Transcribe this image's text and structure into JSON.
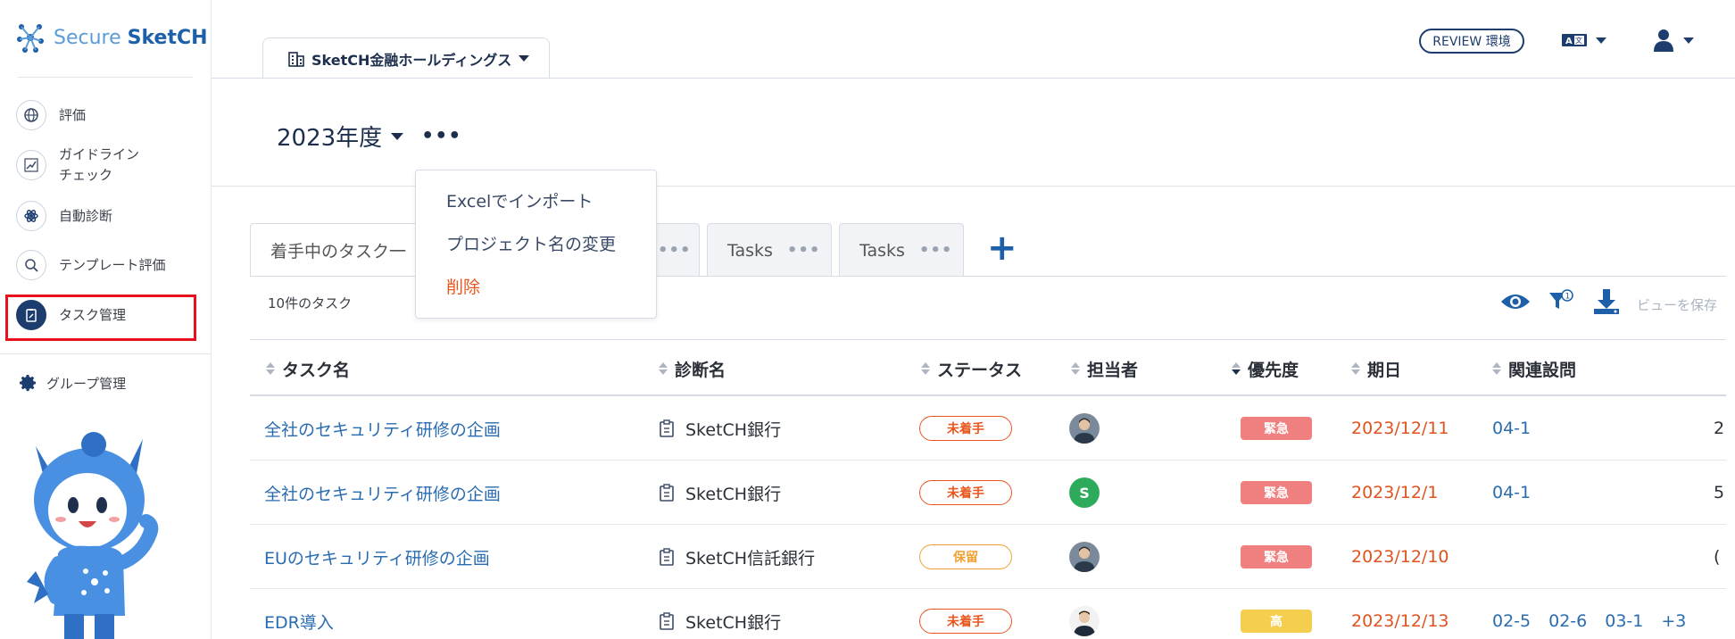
{
  "brand": {
    "name_light": "Secure ",
    "name_bold": "SketCH"
  },
  "sidebar": {
    "items": [
      {
        "label": "評価",
        "icon": "globe-icon"
      },
      {
        "label": "ガイドライン\nチェック",
        "icon": "chart-icon"
      },
      {
        "label": "自動診断",
        "icon": "atom-icon"
      },
      {
        "label": "テンプレート評価",
        "icon": "search-icon"
      },
      {
        "label": "タスク管理",
        "icon": "clipboard-icon",
        "active": true
      }
    ],
    "group_label": "グループ管理"
  },
  "header": {
    "company": "SketCH金融ホールディングス",
    "review_badge": "REVIEW 環境",
    "year": "2023年度",
    "more": "•••"
  },
  "menu": {
    "items": [
      "Excelでインポート",
      "プロジェクト名の変更",
      "削除"
    ]
  },
  "view_tabs": [
    {
      "label": "着手中のタスク一",
      "dots": "•••",
      "active": true
    },
    {
      "label": "Tasks",
      "dots": "•••"
    },
    {
      "label": "Tasks",
      "dots": "•••"
    }
  ],
  "add_tab": "+",
  "toolbar": {
    "count": "10件のタスク",
    "save_view": "ビューを保存",
    "filter_count": "1"
  },
  "table": {
    "columns": [
      "タスク名",
      "診断名",
      "ステータス",
      "担当者",
      "優先度",
      "期日",
      "関連設問"
    ],
    "rows": [
      {
        "task": "全社のセキュリティ研修の企画",
        "diagnosis": "SketCH銀行",
        "status": "未着手",
        "status_color": "#e8561e",
        "assignee": "photo",
        "priority": "緊急",
        "priority_color": "#f08080",
        "due": "2023/12/11",
        "related": [
          "04-1"
        ],
        "edge": "2"
      },
      {
        "task": "全社のセキュリティ研修の企画",
        "diagnosis": "SketCH銀行",
        "status": "未着手",
        "status_color": "#e8561e",
        "assignee": "S",
        "priority": "緊急",
        "priority_color": "#f08080",
        "due": "2023/12/1",
        "related": [
          "04-1"
        ],
        "edge": "5"
      },
      {
        "task": "EUのセキュリティ研修の企画",
        "diagnosis": "SketCH信託銀行",
        "status": "保留",
        "status_color": "#f0a030",
        "assignee": "photo",
        "priority": "緊急",
        "priority_color": "#f08080",
        "due": "2023/12/10",
        "related": [],
        "edge": "("
      },
      {
        "task": "EDR導入",
        "diagnosis": "SketCH銀行",
        "status": "未着手",
        "status_color": "#e8561e",
        "assignee": "photo2",
        "priority": "高",
        "priority_color": "#f5cd4f",
        "due": "2023/12/13",
        "related": [
          "02-5",
          "02-6",
          "03-1",
          "+3"
        ],
        "edge": ""
      }
    ]
  }
}
